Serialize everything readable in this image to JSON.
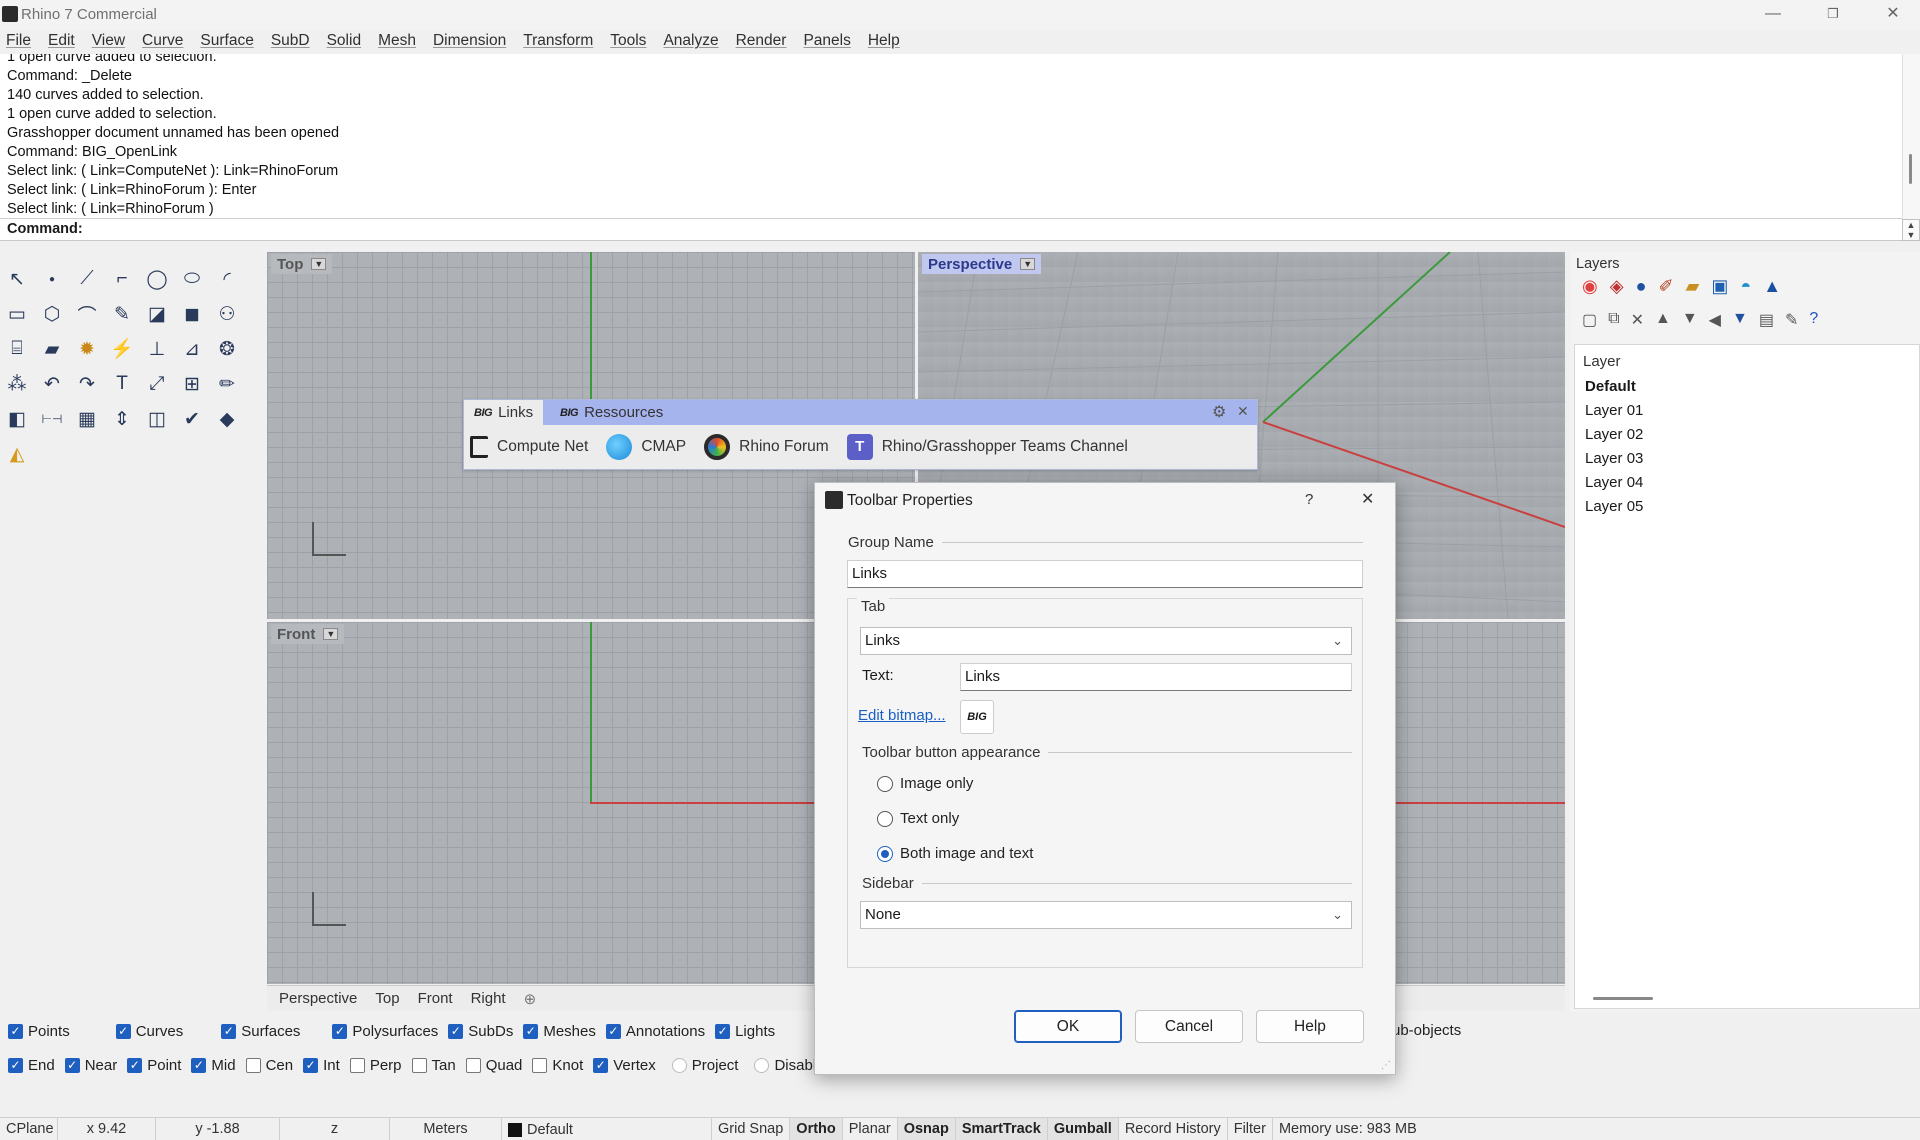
{
  "app": {
    "title": "Rhino 7 Commercial"
  },
  "window_controls": {
    "minimize": "—",
    "maximize": "❐",
    "close": "✕"
  },
  "menu": [
    "File",
    "Edit",
    "View",
    "Curve",
    "Surface",
    "SubD",
    "Solid",
    "Mesh",
    "Dimension",
    "Transform",
    "Tools",
    "Analyze",
    "Render",
    "Panels",
    "Help"
  ],
  "command_history": [
    "1 open curve added to selection.",
    "Command: _Delete",
    "140 curves added to selection.",
    "1 open curve added to selection.",
    "Grasshopper document unnamed has been opened",
    "Command: BIG_OpenLink",
    "Select link: ( Link=ComputeNet ): Link=RhinoForum",
    "Select link: ( Link=RhinoForum ): Enter",
    "Select link: ( Link=RhinoForum )"
  ],
  "command_prompt": {
    "label": "Command:"
  },
  "viewports": {
    "top": "Top",
    "perspective": "Perspective",
    "front": "Front"
  },
  "viewport_tabs": [
    "Perspective",
    "Top",
    "Front",
    "Right",
    "⊕"
  ],
  "links_toolbar": {
    "tabs": [
      {
        "tag": "BIG",
        "label": "Links"
      },
      {
        "tag": "BIG",
        "label": "Ressources"
      }
    ],
    "items": [
      "Compute Net",
      "CMAP",
      "Rhino Forum",
      "Rhino/Grasshopper Teams Channel"
    ]
  },
  "layers_panel": {
    "title": "Layers",
    "column_header": "Layer",
    "layers": [
      "Default",
      "Layer 01",
      "Layer 02",
      "Layer 03",
      "Layer 04",
      "Layer 05"
    ]
  },
  "dialog": {
    "title": "Toolbar Properties",
    "help_glyph": "?",
    "group_name_label": "Group Name",
    "group_name_value": "Links",
    "tab_label": "Tab",
    "tab_select_value": "Links",
    "text_label": "Text:",
    "text_value": "Links",
    "edit_bitmap": "Edit bitmap...",
    "bitmap_tag": "BIG",
    "appearance_label": "Toolbar button appearance",
    "radio_image_only": "Image only",
    "radio_text_only": "Text only",
    "radio_both": "Both image and text",
    "sidebar_label": "Sidebar",
    "sidebar_value": "None",
    "ok": "OK",
    "cancel": "Cancel",
    "help": "Help"
  },
  "object_filters": [
    {
      "label": "Points",
      "checked": true
    },
    {
      "label": "Curves",
      "checked": true
    },
    {
      "label": "Surfaces",
      "checked": true
    },
    {
      "label": "Polysurfaces",
      "checked": true
    },
    {
      "label": "SubDs",
      "checked": true
    },
    {
      "label": "Meshes",
      "checked": true
    },
    {
      "label": "Annotations",
      "checked": true
    },
    {
      "label": "Lights",
      "checked": true
    }
  ],
  "sub_objects_label": "ub-objects",
  "osnaps": [
    {
      "label": "End",
      "checked": true
    },
    {
      "label": "Near",
      "checked": true
    },
    {
      "label": "Point",
      "checked": true
    },
    {
      "label": "Mid",
      "checked": true
    },
    {
      "label": "Cen",
      "checked": false
    },
    {
      "label": "Int",
      "checked": true
    },
    {
      "label": "Perp",
      "checked": false
    },
    {
      "label": "Tan",
      "checked": false
    },
    {
      "label": "Quad",
      "checked": false
    },
    {
      "label": "Knot",
      "checked": false
    },
    {
      "label": "Vertex",
      "checked": true
    },
    {
      "label": "Project",
      "checked": false
    },
    {
      "label": "Disable",
      "checked": false
    }
  ],
  "statusbar": {
    "cplane": "CPlane",
    "x": "x 9.42",
    "y": "y -1.88",
    "z": "z",
    "units": "Meters",
    "layer": "Default",
    "grid_snap": "Grid Snap",
    "ortho": "Ortho",
    "planar": "Planar",
    "osnap": "Osnap",
    "smarttrack": "SmartTrack",
    "gumball": "Gumball",
    "record_history": "Record History",
    "filter": "Filter",
    "memory": "Memory use: 983 MB"
  },
  "colors": {
    "accent": "#1f5fbf",
    "viewport_bg": "#aeb2b7",
    "active_vp_label": "#c0c8f0",
    "toolbar_tabbar": "#a6b4ee"
  }
}
